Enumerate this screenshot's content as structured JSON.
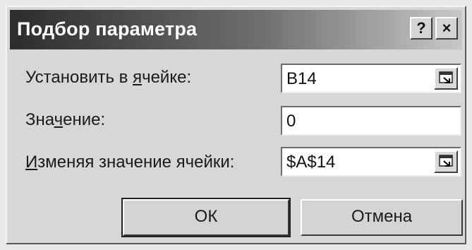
{
  "dialog": {
    "title": "Подбор параметра",
    "help_label": "?",
    "close_label": "×"
  },
  "fields": {
    "set_cell": {
      "label_pre": "Установить в ",
      "label_accel": "я",
      "label_post": "чейке:",
      "value": "B14"
    },
    "to_value": {
      "label_pre": "Зна",
      "label_accel": "ч",
      "label_post": "ение:",
      "value": "0"
    },
    "changing_cell": {
      "label_pre": "",
      "label_accel": "И",
      "label_post": "зменяя значение ячейки:",
      "value": "$A$14"
    }
  },
  "buttons": {
    "ok_label": "ОК",
    "cancel_label": "Отмена"
  }
}
